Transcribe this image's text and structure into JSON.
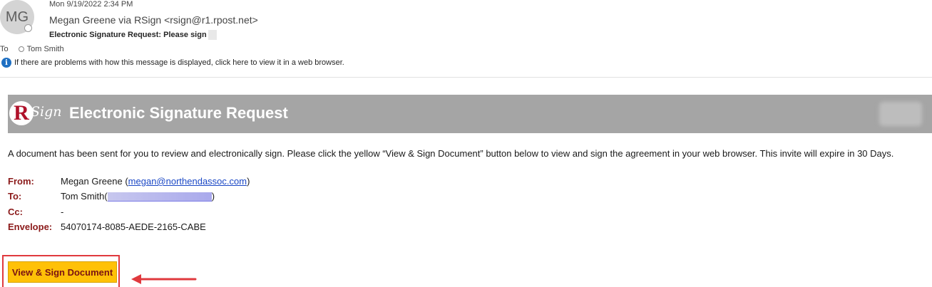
{
  "header": {
    "avatar_initials": "MG",
    "date": "Mon 9/19/2022 2:34 PM",
    "from": "Megan Greene via RSign <rsign@r1.rpost.net>",
    "subject": "Electronic Signature Request: Please sign",
    "to_label": "To",
    "to_name": "Tom Smith",
    "info_message": "If there are problems with how this message is displayed, click here to view it in a web browser."
  },
  "banner": {
    "logo_r": "R",
    "logo_sign": "Sign",
    "title": "Electronic Signature Request"
  },
  "body": {
    "intro": "A document has been sent for you to review and electronically sign. Please click the yellow “View & Sign Document” button below to view and sign the agreement in your web browser. This invite will expire in 30 Days."
  },
  "fields": {
    "from_label": "From:",
    "from_name": "Megan Greene (",
    "from_email": "megan@northendassoc.com",
    "from_close": ")",
    "to_label": "To:",
    "to_name": "Tom Smith(",
    "to_close": ")",
    "cc_label": "Cc:",
    "cc_value": "-",
    "envelope_label": "Envelope:",
    "envelope_value": "54070174-8085-AEDE-2165-CABE"
  },
  "action": {
    "button_label": "View & Sign Document"
  },
  "colors": {
    "banner_bg": "#a5a5a5",
    "label_red": "#8b1a1a",
    "button_yellow": "#ffc107",
    "highlight_red": "#e0393e",
    "link_blue": "#1a47c5"
  }
}
